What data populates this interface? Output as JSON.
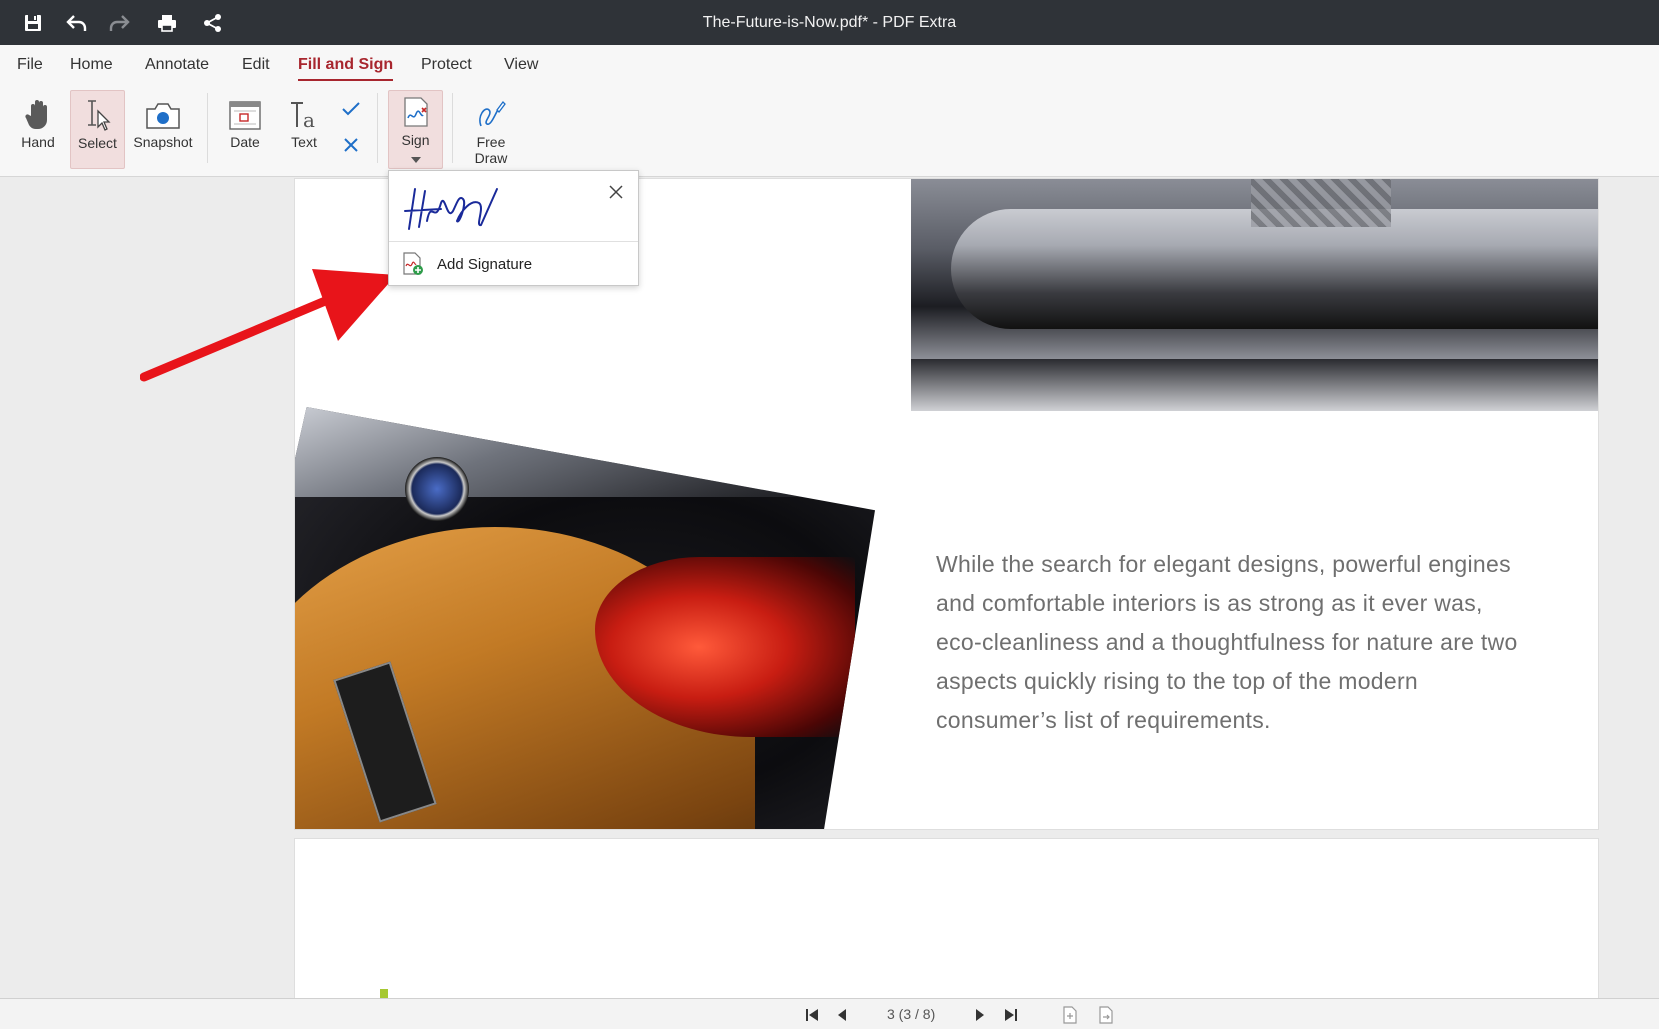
{
  "app": {
    "window_title": "The-Future-is-Now.pdf* - PDF Extra"
  },
  "quick_access": {
    "icons": [
      "save-icon",
      "undo-icon",
      "redo-icon",
      "print-icon",
      "share-icon"
    ]
  },
  "menu": {
    "tabs": [
      {
        "label": "File",
        "active": false
      },
      {
        "label": "Home",
        "active": false
      },
      {
        "label": "Annotate",
        "active": false
      },
      {
        "label": "Edit",
        "active": false
      },
      {
        "label": "Fill and Sign",
        "active": true
      },
      {
        "label": "Protect",
        "active": false
      },
      {
        "label": "View",
        "active": false
      }
    ]
  },
  "ribbon": {
    "hand": "Hand",
    "select": "Select",
    "snapshot": "Snapshot",
    "date": "Date",
    "text": "Text",
    "sign": "Sign",
    "free_draw_line1": "Free",
    "free_draw_line2": "Draw"
  },
  "sign_menu": {
    "add_signature": "Add Signature"
  },
  "document": {
    "paragraph": "While the search for elegant designs, powerful engines and comfortable interiors is as strong as it ever was, eco-cleanliness and a thoughtfulness for nature are two aspects quickly rising to the top of the modern consumer’s list of requirements."
  },
  "status": {
    "page_indicator": "3 (3 / 8)"
  },
  "colors": {
    "accent": "#a8262e",
    "titlebar": "#2f3338",
    "arrow": "#e8141a",
    "signature_ink": "#1a2a9a"
  }
}
